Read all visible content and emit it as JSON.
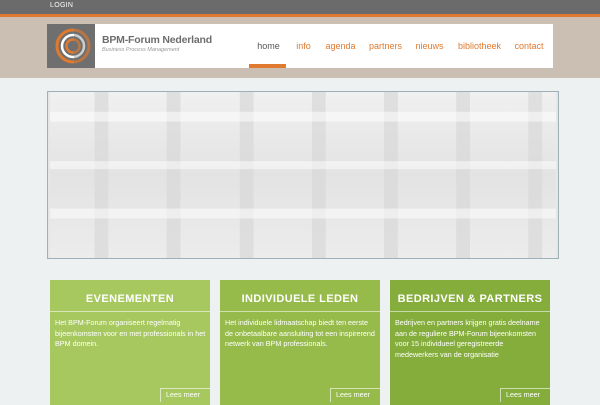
{
  "topbar": {
    "login_label": "LOGIN"
  },
  "brand": {
    "name": "BPM-Forum Nederland",
    "tagline": "Business Process Management"
  },
  "nav": {
    "items": [
      {
        "label": "home"
      },
      {
        "label": "info"
      },
      {
        "label": "agenda"
      },
      {
        "label": "partners"
      },
      {
        "label": "nieuws"
      },
      {
        "label": "bibliotheek"
      },
      {
        "label": "contact"
      }
    ],
    "active": "home"
  },
  "cards": [
    {
      "title": "EVENEMENTEN",
      "text": "Het BPM-Forum organiseert regelmatig bijeenkomsten voor en met professionals in het BPM domein.",
      "link": "Lees meer",
      "color": "#a7c85e"
    },
    {
      "title": "INDIVIDUELE LEDEN",
      "text": "Het individuele lidmaatschap biedt ten eerste de onbetaalbare aansluiting tot een inspirerend netwerk van BPM professionals.",
      "link": "Lees meer",
      "color": "#96bb4a"
    },
    {
      "title": "BEDRIJVEN & PARTNERS",
      "text": "Bedrijven en partners krijgen gratis deelname aan de reguliere BPM-Forum bijeenkomsten voor 15 individueel geregistreerde medewerkers van de organisatie",
      "link": "Lees meer",
      "color": "#85ad3c"
    }
  ],
  "colors": {
    "accent": "#e07a2e",
    "topbar": "#6b6b6b",
    "header_band": "#cbbfb3"
  }
}
